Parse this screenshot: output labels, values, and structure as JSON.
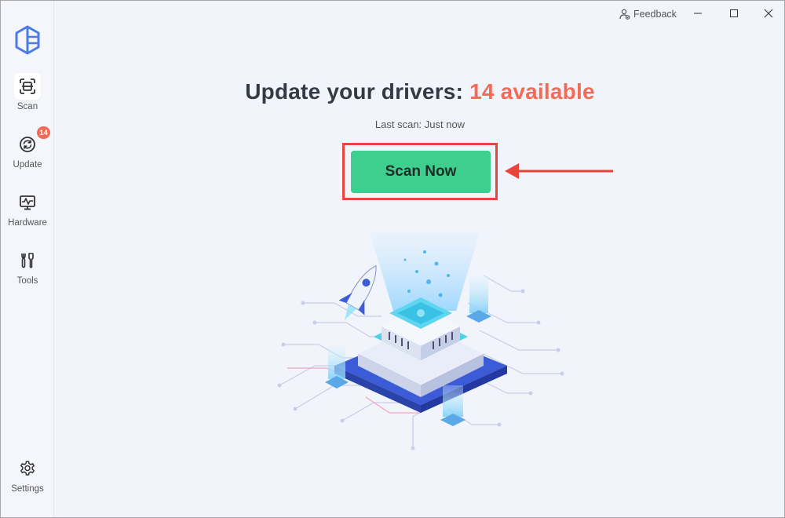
{
  "titlebar": {
    "feedback_label": "Feedback"
  },
  "sidebar": {
    "items": [
      {
        "label": "Scan",
        "icon": "scan-icon",
        "active": true
      },
      {
        "label": "Update",
        "icon": "update-icon",
        "badge": "14"
      },
      {
        "label": "Hardware",
        "icon": "hardware-icon"
      },
      {
        "label": "Tools",
        "icon": "tools-icon"
      }
    ],
    "settings_label": "Settings"
  },
  "main": {
    "headline_prefix": "Update your drivers:",
    "headline_count": "14 available",
    "last_scan": "Last scan: Just now",
    "scan_button_label": "Scan Now"
  },
  "colors": {
    "accent_green": "#3ecf8e",
    "accent_red": "#f26b57",
    "highlight_red": "#e8453c",
    "logo_blue": "#4b7be5"
  }
}
